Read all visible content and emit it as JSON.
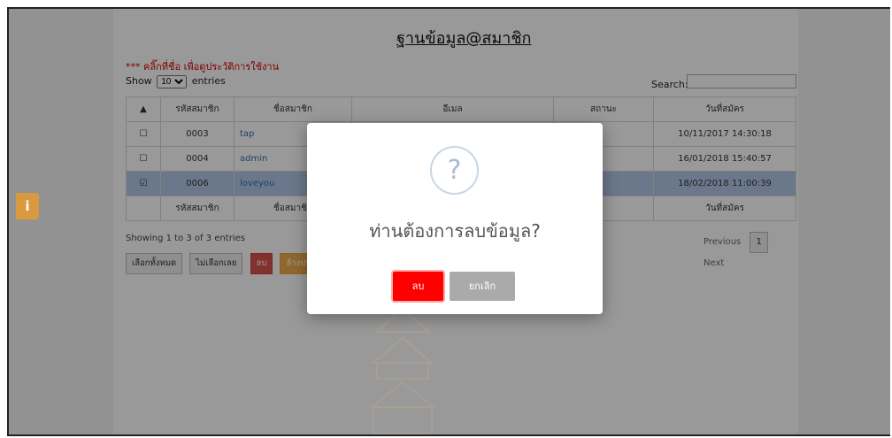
{
  "page": {
    "title": "ฐานข้อมูล@สมาชิก",
    "note": "*** คลิ๊กที่ชื่อ เพื่อดูประวัติการใช้งาน"
  },
  "table_controls": {
    "show_label": "Show",
    "show_value": "10",
    "entries_label": "entries",
    "search_label": "Search:"
  },
  "table": {
    "headers": [
      "",
      "รหัสสมาชิก",
      "ชื่อสมาชิก",
      "อีเมล",
      "สถานะ",
      "วันที่สมัคร"
    ],
    "rows": [
      {
        "id": "0003",
        "name": "tap",
        "date": "10/11/2017 14:30:18",
        "checked": false
      },
      {
        "id": "0004",
        "name": "admin",
        "date": "16/01/2018 15:40:57",
        "checked": false
      },
      {
        "id": "0006",
        "name": "loveyou",
        "date": "18/02/2018 11:00:39",
        "checked": true
      }
    ],
    "footers": [
      "",
      "รหัสสมาชิก",
      "ชื่อสมาชิก",
      "",
      "",
      "วันที่สมัคร"
    ],
    "showing": "Showing 1 to 3 of 3 entries"
  },
  "pagination": {
    "previous": "Previous",
    "current": "1",
    "next": "Next"
  },
  "actions": {
    "select_all": "เลือกทั้งหมด",
    "deselect_all": "ไม่เลือกเลย",
    "delete": "ลบ",
    "update": "ล้างประวัติ"
  },
  "modal": {
    "icon": "question-icon",
    "message": "ท่านต้องการลบข้อมูล?",
    "confirm_label": "ลบ",
    "cancel_label": "ยกเลิก"
  },
  "colors": {
    "confirm": "#ff0000",
    "cancel": "#aaaaaa",
    "selected_row": "#b3c9ea",
    "note": "#d40000"
  }
}
